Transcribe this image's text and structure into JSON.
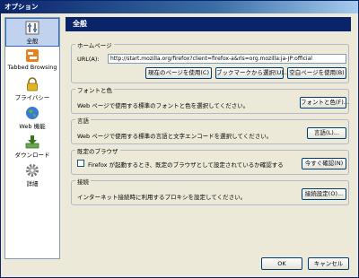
{
  "window": {
    "title": "オプション"
  },
  "sidebar": {
    "items": [
      {
        "label": "全般",
        "icon": "general-icon"
      },
      {
        "label": "Tabbed Browsing",
        "icon": "tabs-icon"
      },
      {
        "label": "プライバシー",
        "icon": "privacy-icon"
      },
      {
        "label": "Web 機能",
        "icon": "web-features-icon"
      },
      {
        "label": "ダウンロード",
        "icon": "downloads-icon"
      },
      {
        "label": "詳細",
        "icon": "advanced-icon"
      }
    ]
  },
  "panel": {
    "title": "全般"
  },
  "homepage": {
    "group_label": "ホームページ",
    "url_label": "URL(A):",
    "url_value": "http://start.mozilla.org/firefox?client=firefox-a&rls=org.mozilla:ja-JP:official",
    "btn_current": "現在のページを使用(C)",
    "btn_bookmark": "ブックマークから選択(U)...",
    "btn_blank": "空白ページを使用(B)"
  },
  "fonts": {
    "group_label": "フォントと色",
    "desc": "Web ページで使用する標準のフォントと色を選択してください。",
    "button": "フォントと色(F)..."
  },
  "languages": {
    "group_label": "言語",
    "desc": "Web ページで使用する標準の言語と文字エンコードを選択してください。",
    "button": "言語(L)..."
  },
  "default_browser": {
    "group_label": "既定のブラウザ",
    "checkbox_label": "Firefox が起動するとき、既定のブラウザとして設定されているか確認する",
    "checked": false,
    "button": "今すぐ確認(N)"
  },
  "connection": {
    "group_label": "接続",
    "desc": "インターネット接続時に利用するプロキシを設定してください。",
    "button": "接続設定(O)..."
  },
  "footer": {
    "ok": "OK",
    "cancel": "キャンセル"
  }
}
